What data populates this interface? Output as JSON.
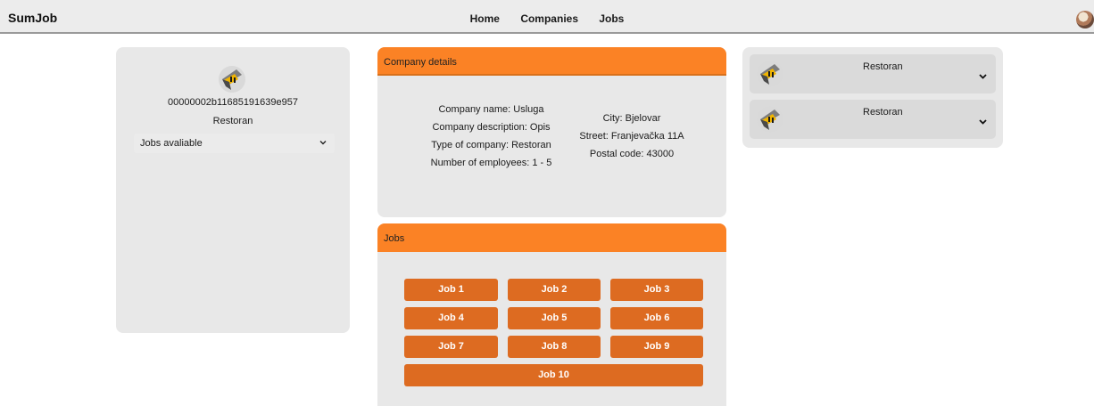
{
  "header": {
    "brand": "SumJob",
    "nav": [
      "Home",
      "Companies",
      "Jobs"
    ]
  },
  "profile": {
    "id": "00000002b11685191639e957",
    "type": "Restoran",
    "jobs_dropdown_label": "Jobs avaliable"
  },
  "company_details": {
    "title": "Company details",
    "left": [
      "Company name: Usluga",
      "Company description: Opis",
      "Type of company: Restoran",
      "Number of employees: 1 - 5"
    ],
    "right": [
      "City: Bjelovar",
      "Street: Franjevačka 11A",
      "Postal code: 43000"
    ]
  },
  "jobs": {
    "title": "Jobs",
    "items": [
      "Job 1",
      "Job 2",
      "Job 3",
      "Job 4",
      "Job 5",
      "Job 6",
      "Job 7",
      "Job 8",
      "Job 9",
      "Job 10"
    ]
  },
  "sidebar": {
    "items": [
      {
        "label": "Restoran"
      },
      {
        "label": "Restoran"
      }
    ]
  },
  "colors": {
    "accent": "#fb8225",
    "job_button": "#dd6b21",
    "card_bg": "#e8e8e8"
  }
}
